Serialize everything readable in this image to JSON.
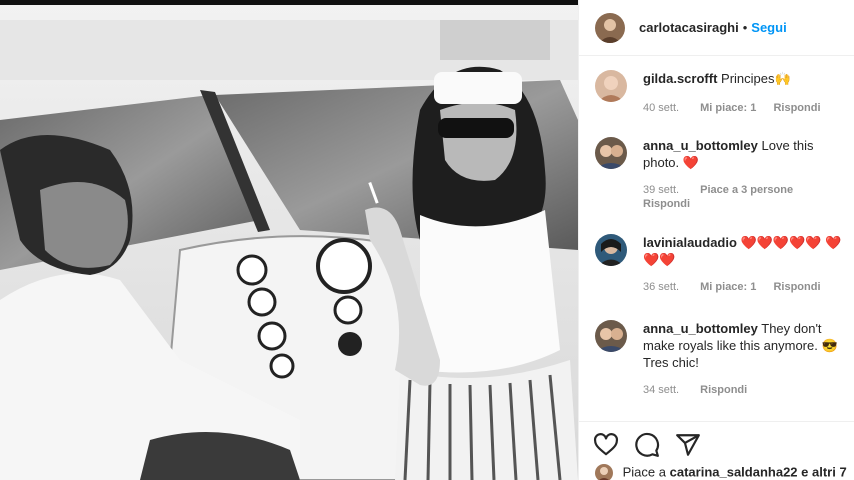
{
  "post": {
    "username": "carlotacasiraghi",
    "separator": "•",
    "follow_label": "Segui"
  },
  "comments": [
    {
      "username": "gilda.scrofft",
      "text": "Principes🙌",
      "time": "40 sett.",
      "likes": "Mi piace: 1",
      "reply": "Rispondi"
    },
    {
      "username": "anna_u_bottomley",
      "text": "Love this photo.",
      "emoji": "❤️",
      "time": "39 sett.",
      "likes": "Piace a 3 persone",
      "reply": "Rispondi"
    },
    {
      "username": "lavinialaudadio",
      "text": "❤️❤️❤️❤️❤️ ❤️❤️❤️",
      "time": "36 sett.",
      "likes": "Mi piace: 1",
      "reply": "Rispondi"
    },
    {
      "username": "anna_u_bottomley",
      "text": "They don't make royals like this anymore. 😎 Tres chic!",
      "time": "34 sett.",
      "reply": "Rispondi"
    }
  ],
  "likes_line": {
    "prefix": "Piace a",
    "user": "catarina_saldanha22",
    "suffix": "e altri 7"
  },
  "icons": [
    "heart-icon",
    "comment-icon",
    "share-icon"
  ],
  "colors": {
    "link_blue": "#0095f6",
    "meta_gray": "#8e8e8e",
    "heart_red": "#ed1c24"
  }
}
